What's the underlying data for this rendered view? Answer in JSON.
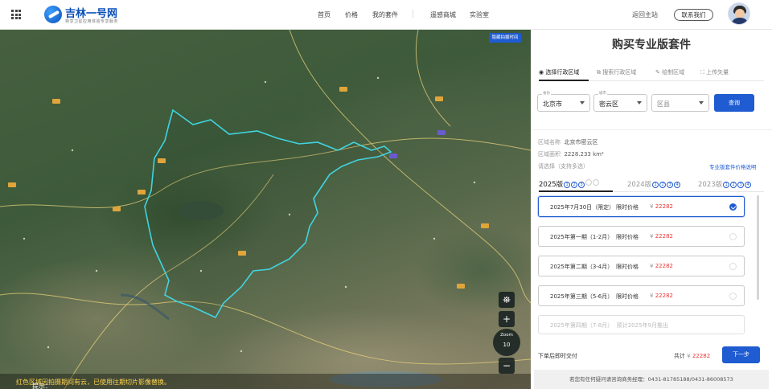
{
  "header": {
    "brand_title": "吉林一号网",
    "brand_sub": "特享卫星应用体验专享服务",
    "nav": [
      "首页",
      "价格",
      "我的套件",
      "遥感商城",
      "实验室"
    ],
    "home_link": "返回主站",
    "contact_btn": "联系我们"
  },
  "map": {
    "hide_time_btn": "隐藏拍摄时间",
    "tip_prefix": "提示：",
    "tip_text": "红色区域因拍摄期间有云，已使用往期切片影像替换。",
    "zoom_label": "Zoom",
    "zoom_level": "10",
    "controls": [
      "+",
      "−"
    ]
  },
  "panel": {
    "title": "购买专业版套件",
    "tabs": [
      "选择行政区域",
      "搜索行政区域",
      "绘制区域",
      "上传矢量"
    ],
    "province": {
      "label": "省份",
      "value": "北京市"
    },
    "city": {
      "label": "城市",
      "value": "密云区"
    },
    "district": {
      "placeholder": "区县"
    },
    "query_btn": "查询",
    "area_name_label": "区域名称",
    "area_name": "北京市密云区",
    "area_size_label": "区域面积",
    "area_size": "2228.233  km²",
    "select_hint": "请选择（支持多选）",
    "price_link": "专业版套件价格说明",
    "versions": [
      {
        "label": "2025版",
        "marks": [
          "1",
          "2",
          "3",
          "",
          ""
        ]
      },
      {
        "label": "2024版",
        "marks": [
          "1",
          "2",
          "3",
          "4"
        ]
      },
      {
        "label": "2023版",
        "marks": [
          "1",
          "2",
          "3",
          "4"
        ]
      }
    ],
    "price_label": "限时价格",
    "currency": "¥",
    "packages": [
      {
        "name": "2025年7月30日（限定）",
        "price": "22282",
        "selected": true
      },
      {
        "name": "2025年第一期（1-2月）",
        "price": "22282",
        "selected": false
      },
      {
        "name": "2025年第二期（3-4月）",
        "price": "22282",
        "selected": false
      },
      {
        "name": "2025年第三期（5-6月）",
        "price": "22282",
        "selected": false
      },
      {
        "name": "2025年第四期（7-8月）",
        "note": "预计2025年9月推出",
        "selected": false
      }
    ],
    "footer_left": "下单后即时交付",
    "total_label": "共计",
    "total_amount": "22282",
    "next_btn": "下一步",
    "contact_bar": "若您有任何疑问请咨询商务经理：0431-81785188/0431-86008573"
  }
}
